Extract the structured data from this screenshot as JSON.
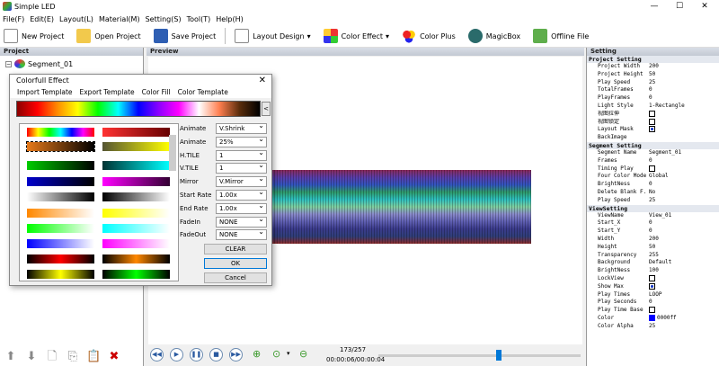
{
  "window": {
    "title": "Simple LED",
    "minimize": "—",
    "maximize": "☐",
    "close": "✕"
  },
  "menu": [
    "File(F)",
    "Edit(E)",
    "Layout(L)",
    "Material(M)",
    "Setting(S)",
    "Tool(T)",
    "Help(H)"
  ],
  "toolbar": {
    "new_project": "New Project",
    "open_project": "Open Project",
    "save_project": "Save Project",
    "layout_design": "Layout Design",
    "color_effect": "Color Effect",
    "color_plus": "Color Plus",
    "magicbox": "MagicBox",
    "offline_file": "Offline File"
  },
  "project_panel": {
    "header": "Project",
    "tree_item": "Segment_01"
  },
  "preview_panel": {
    "header": "Preview"
  },
  "playbar": {
    "frame_counter": "173/257",
    "time": "00:00:06/00:00:04",
    "progress": 0.58
  },
  "dialog": {
    "title": "Colorfull Effect",
    "menu": [
      "Import Template",
      "Export Template",
      "Color Fill",
      "Color Template"
    ],
    "spectrum_button": "<",
    "params": [
      {
        "label": "Animate",
        "value": "V.Shrink"
      },
      {
        "label": "Animate",
        "value": "25%"
      },
      {
        "label": "H.TILE",
        "value": "1"
      },
      {
        "label": "V.TILE",
        "value": "1"
      },
      {
        "label": "Mirror",
        "value": "V.Mirror"
      },
      {
        "label": "Start Rate",
        "value": "1.00x"
      },
      {
        "label": "End Rate",
        "value": "1.00x"
      },
      {
        "label": "FadeIn",
        "value": "NONE"
      },
      {
        "label": "FadeOut",
        "value": "NONE"
      }
    ],
    "clear": "CLEAR",
    "ok": "OK",
    "cancel": "Cancel"
  },
  "setting_panel": {
    "header": "Setting",
    "groups": [
      {
        "title": "Project Setting",
        "rows": [
          {
            "k": "Project Width",
            "v": "200"
          },
          {
            "k": "Project Height",
            "v": "50"
          },
          {
            "k": "Play Speed",
            "v": "25"
          },
          {
            "k": "TotalFrames",
            "v": "0"
          },
          {
            "k": "PlayFrames",
            "v": "0"
          },
          {
            "k": "Light Style",
            "v": "1-Rectangle"
          },
          {
            "k": "视图拉伸",
            "v": "",
            "check": "off"
          },
          {
            "k": "视图锁定",
            "v": "",
            "check": "off"
          },
          {
            "k": "Layout Mask",
            "v": "",
            "check": "on"
          },
          {
            "k": "BackImage",
            "v": ""
          }
        ]
      },
      {
        "title": "Segment Setting",
        "rows": [
          {
            "k": "Segment Name",
            "v": "Segment_01"
          },
          {
            "k": "Frames",
            "v": "0"
          },
          {
            "k": "Timing Play",
            "v": "",
            "check": "off"
          },
          {
            "k": "Four Color Mode",
            "v": "Global"
          },
          {
            "k": "BrightNess",
            "v": "0"
          },
          {
            "k": "Delete Blank F...",
            "v": "No"
          },
          {
            "k": "Play Speed",
            "v": "25"
          }
        ]
      },
      {
        "title": "ViewSetting",
        "rows": [
          {
            "k": "ViewName",
            "v": "View_01"
          },
          {
            "k": "Start_X",
            "v": "0"
          },
          {
            "k": "Start_Y",
            "v": "0"
          },
          {
            "k": "Width",
            "v": "200"
          },
          {
            "k": "Height",
            "v": "50"
          },
          {
            "k": "Transparency",
            "v": "255"
          },
          {
            "k": "Background",
            "v": "Default"
          },
          {
            "k": "BrightNess",
            "v": "100"
          },
          {
            "k": "LockView",
            "v": "",
            "check": "off"
          },
          {
            "k": "Show Max",
            "v": "",
            "check": "on"
          },
          {
            "k": "Play Times",
            "v": "LOOP"
          },
          {
            "k": "Play Seconds",
            "v": "0"
          },
          {
            "k": "Play Time Base",
            "v": "",
            "check": "off"
          },
          {
            "k": "Color",
            "v": "0000ff",
            "swatch": "#0000ff"
          },
          {
            "k": "Color Alpha",
            "v": "25"
          }
        ]
      }
    ]
  }
}
